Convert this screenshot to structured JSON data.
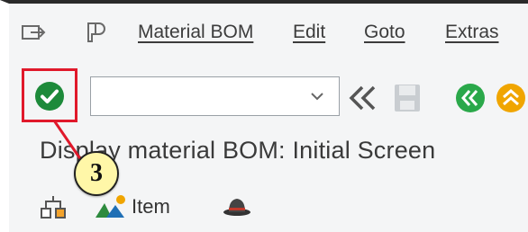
{
  "menubar": {
    "items": [
      {
        "label": "Material BOM"
      },
      {
        "label": "Edit"
      },
      {
        "label": "Goto"
      },
      {
        "label": "Extras"
      }
    ]
  },
  "toolbar": {
    "command_field": {
      "value": "",
      "placeholder": ""
    },
    "icons": [
      "checkmark-icon",
      "back-icon",
      "save-icon",
      "previous-icon",
      "up-icon"
    ]
  },
  "title": "Display material BOM: Initial Screen",
  "app_toolbar": {
    "item_label": "Item"
  },
  "annotation": {
    "step": "3"
  },
  "colors": {
    "ok_green": "#1d8a3a",
    "highlight_red": "#e0192b",
    "callout_yellow": "#fff7a8",
    "nav_green": "#2aa84a",
    "nav_orange": "#f0a500"
  }
}
